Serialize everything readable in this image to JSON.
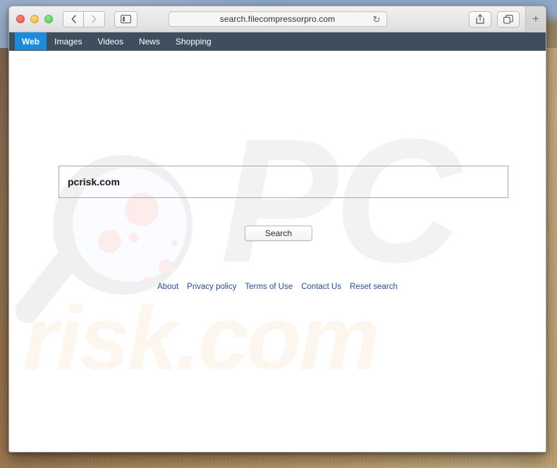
{
  "browser": {
    "traffic_lights": [
      "close",
      "minimize",
      "zoom"
    ],
    "back_label": "‹",
    "forward_label": "›",
    "sidebar_icon": "sidebar-icon",
    "url": "search.filecompressorpro.com",
    "reload_icon": "↻",
    "share_icon": "share-icon",
    "tabs_icon": "tabs-icon",
    "new_tab_label": "+"
  },
  "site_nav": {
    "items": [
      {
        "label": "Web",
        "active": true
      },
      {
        "label": "Images",
        "active": false
      },
      {
        "label": "Videos",
        "active": false
      },
      {
        "label": "News",
        "active": false
      },
      {
        "label": "Shopping",
        "active": false
      }
    ]
  },
  "search": {
    "query": "pcrisk.com",
    "placeholder": "",
    "button_label": "Search"
  },
  "footer": {
    "links": [
      "About",
      "Privacy policy",
      "Terms of Use",
      "Contact Us",
      "Reset search"
    ]
  },
  "watermarks": {
    "pc_text": "PC",
    "risk_text": "risk.com",
    "glass_icon": "magnifying-glass-icon"
  },
  "colors": {
    "nav_background": "#3f4e5e",
    "nav_active": "#1b8cdd",
    "link": "#2a4b9b",
    "wm_pc": "#f2f2f2",
    "wm_risk": "#fdf6ef",
    "desktop": "#c8a878"
  }
}
